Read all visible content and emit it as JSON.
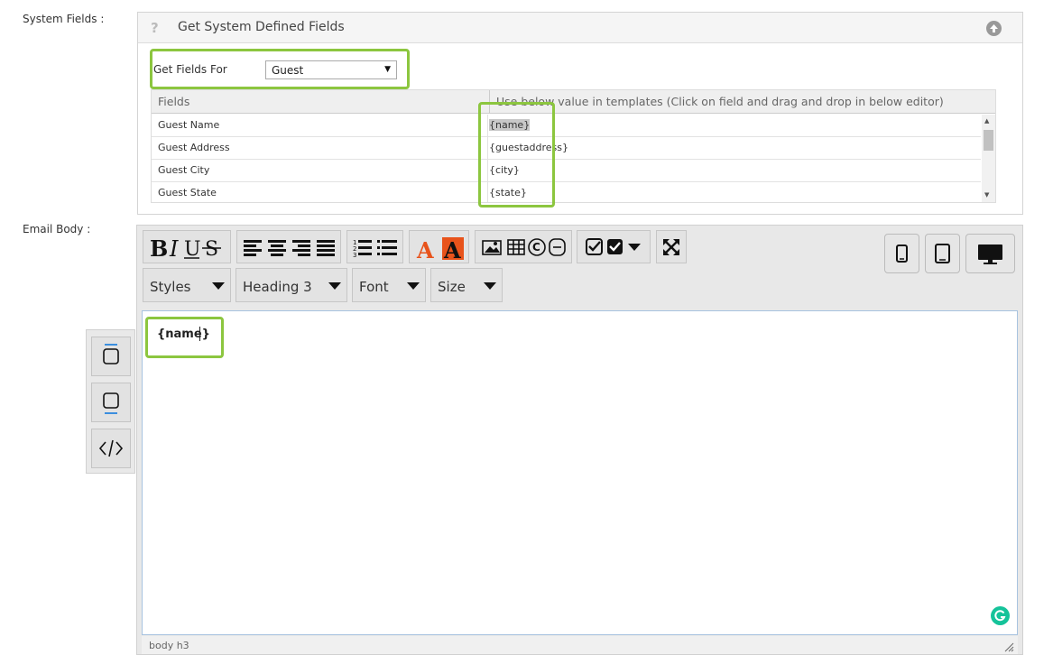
{
  "labels": {
    "system_fields": "System Fields :",
    "email_body": "Email Body :"
  },
  "system_panel": {
    "title": "Get System Defined Fields",
    "help_icon": "?",
    "collapse_icon": "circle-arrow-up-icon",
    "get_fields_for_label": "Get Fields For",
    "get_fields_for_value": "Guest",
    "table": {
      "headers": [
        "Fields",
        "Use below value in templates (Click on field and drag and drop in below editor)"
      ],
      "rows": [
        {
          "field": "Guest Name",
          "value": "{name}"
        },
        {
          "field": "Guest Address",
          "value": "{guestaddress}"
        },
        {
          "field": "Guest City",
          "value": "{city}"
        },
        {
          "field": "Guest State",
          "value": "{state}"
        }
      ]
    }
  },
  "editor": {
    "toolbar_icons": [
      "bold-icon",
      "italic-icon",
      "underline-icon",
      "strikethrough-icon",
      "align-left-icon",
      "align-center-icon",
      "align-right-icon",
      "align-justify-icon",
      "ordered-list-icon",
      "unordered-list-icon",
      "text-color-icon",
      "background-color-icon",
      "image-icon",
      "table-icon",
      "special-char-icon",
      "horizontal-rule-icon",
      "spellcheck-icon",
      "fullscreen-icon"
    ],
    "dropdowns": {
      "styles": "Styles",
      "heading": "Heading 3",
      "font": "Font",
      "size": "Size"
    },
    "device_icons": [
      "mobile-icon",
      "tablet-icon",
      "desktop-icon"
    ],
    "content": "{name}",
    "status_path": "body  h3",
    "accent_colors": {
      "text_color": "#e8531b",
      "highlight": "#8cc63f",
      "grammarly": "#15c39a"
    }
  },
  "side_toolbar": [
    "top-margin-icon",
    "bottom-margin-icon",
    "code-view-icon"
  ]
}
